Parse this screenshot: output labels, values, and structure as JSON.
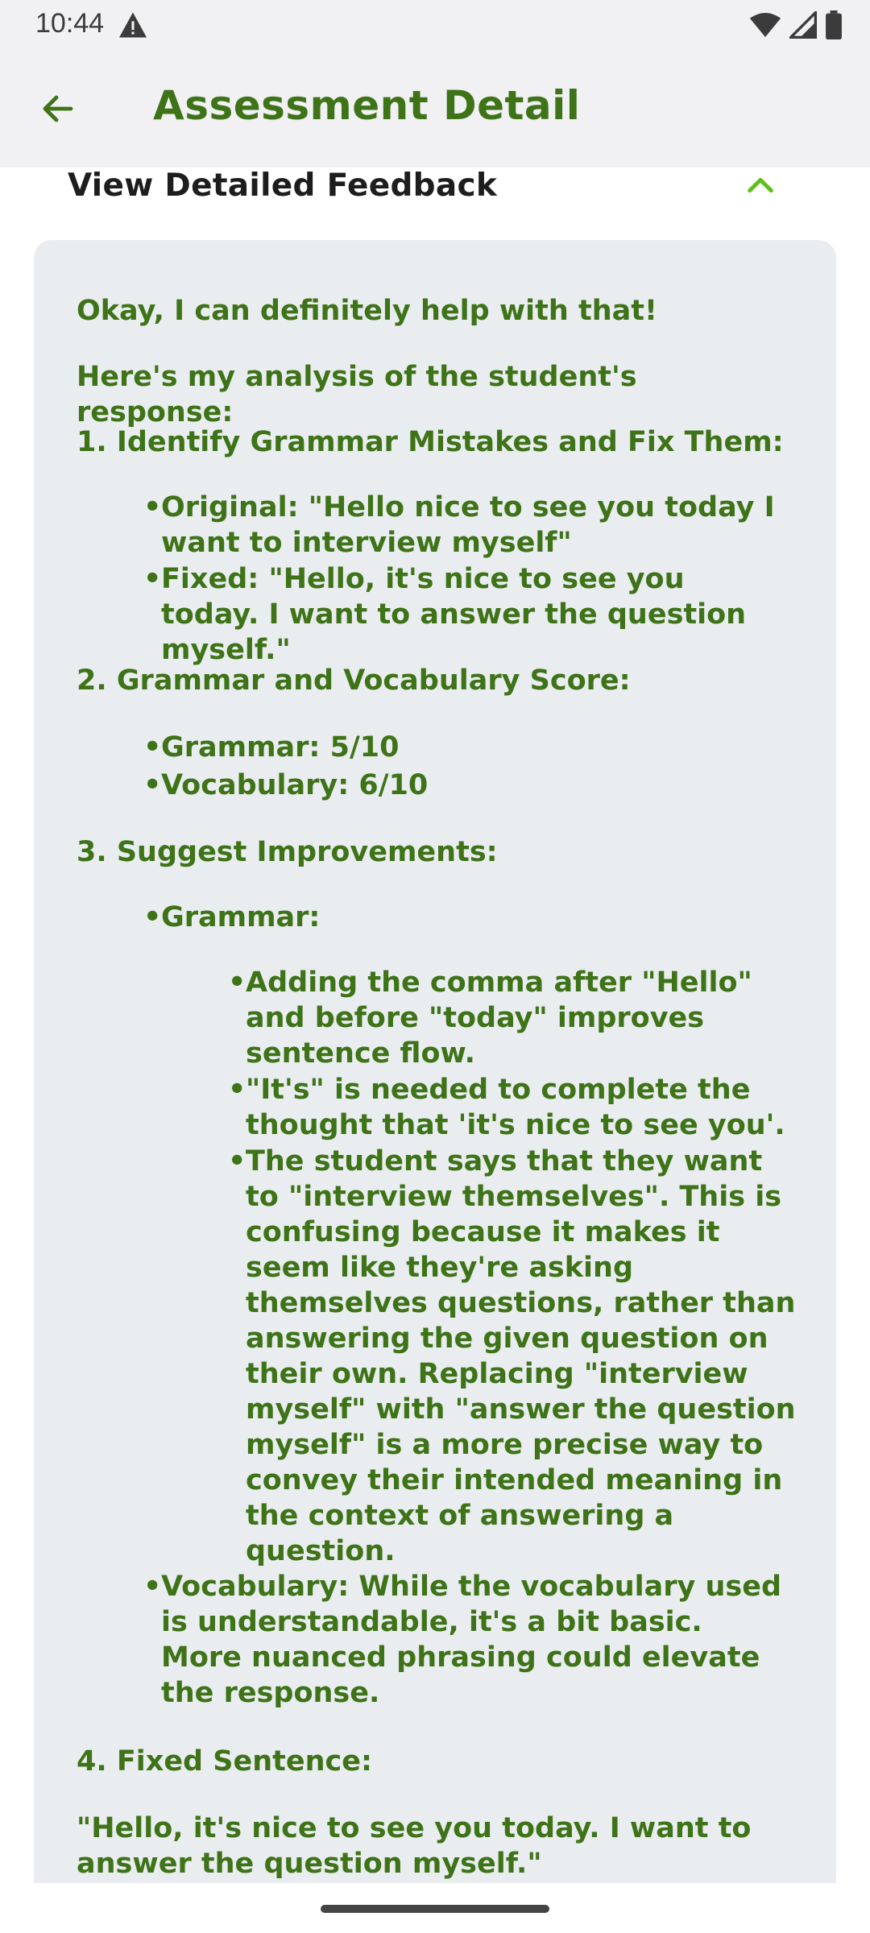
{
  "status_bar": {
    "time": "10:44",
    "icons": [
      "alert-triangle-icon",
      "wifi-icon",
      "cellular-signal-icon",
      "battery-icon"
    ]
  },
  "app_bar": {
    "back_icon": "arrow-left-icon",
    "title": "Assessment Detail"
  },
  "feedback_section": {
    "header_label": "View Detailed Feedback",
    "chevron_icon": "chevron-up-icon",
    "intro": "Okay, I can definitely help with that!",
    "analysis_intro": "Here's my analysis of the student's response:",
    "section1": {
      "heading": "1. Identify Grammar Mistakes and Fix Them:",
      "original": "Original: \"Hello nice to see you today I want to interview myself\"",
      "fixed": "Fixed: \"Hello, it's nice to see you today. I want to answer the question myself.\""
    },
    "section2": {
      "heading": "2. Grammar and Vocabulary Score:",
      "grammar_score": "Grammar: 5/10",
      "vocabulary_score": "Vocabulary: 6/10"
    },
    "section3": {
      "heading": "3. Suggest Improvements:",
      "grammar_label": "Grammar:",
      "grammar_points": [
        "Adding the comma after \"Hello\" and before \"today\" improves sentence flow.",
        "\"It's\" is needed to complete the thought that 'it's nice to see you'.",
        "The student says that they want to \"interview themselves\". This is confusing because it makes it seem like they're asking themselves questions, rather than answering the given question on their own. Replacing \"interview myself\" with \"answer the question myself\" is a more precise way to convey their intended meaning in the context of answering a question."
      ],
      "vocabulary": "Vocabulary: While the vocabulary used is understandable, it's a bit basic. More nuanced phrasing could elevate the response."
    },
    "section4": {
      "heading": "4. Fixed Sentence:",
      "sentence": "\"Hello, it's nice to see you today. I want to answer the question myself.\""
    }
  },
  "colors": {
    "accent": "#3e7318",
    "chevron": "#5fbf1a",
    "card_background": "#eaedf0",
    "app_bar_background": "#f1f1f4"
  }
}
